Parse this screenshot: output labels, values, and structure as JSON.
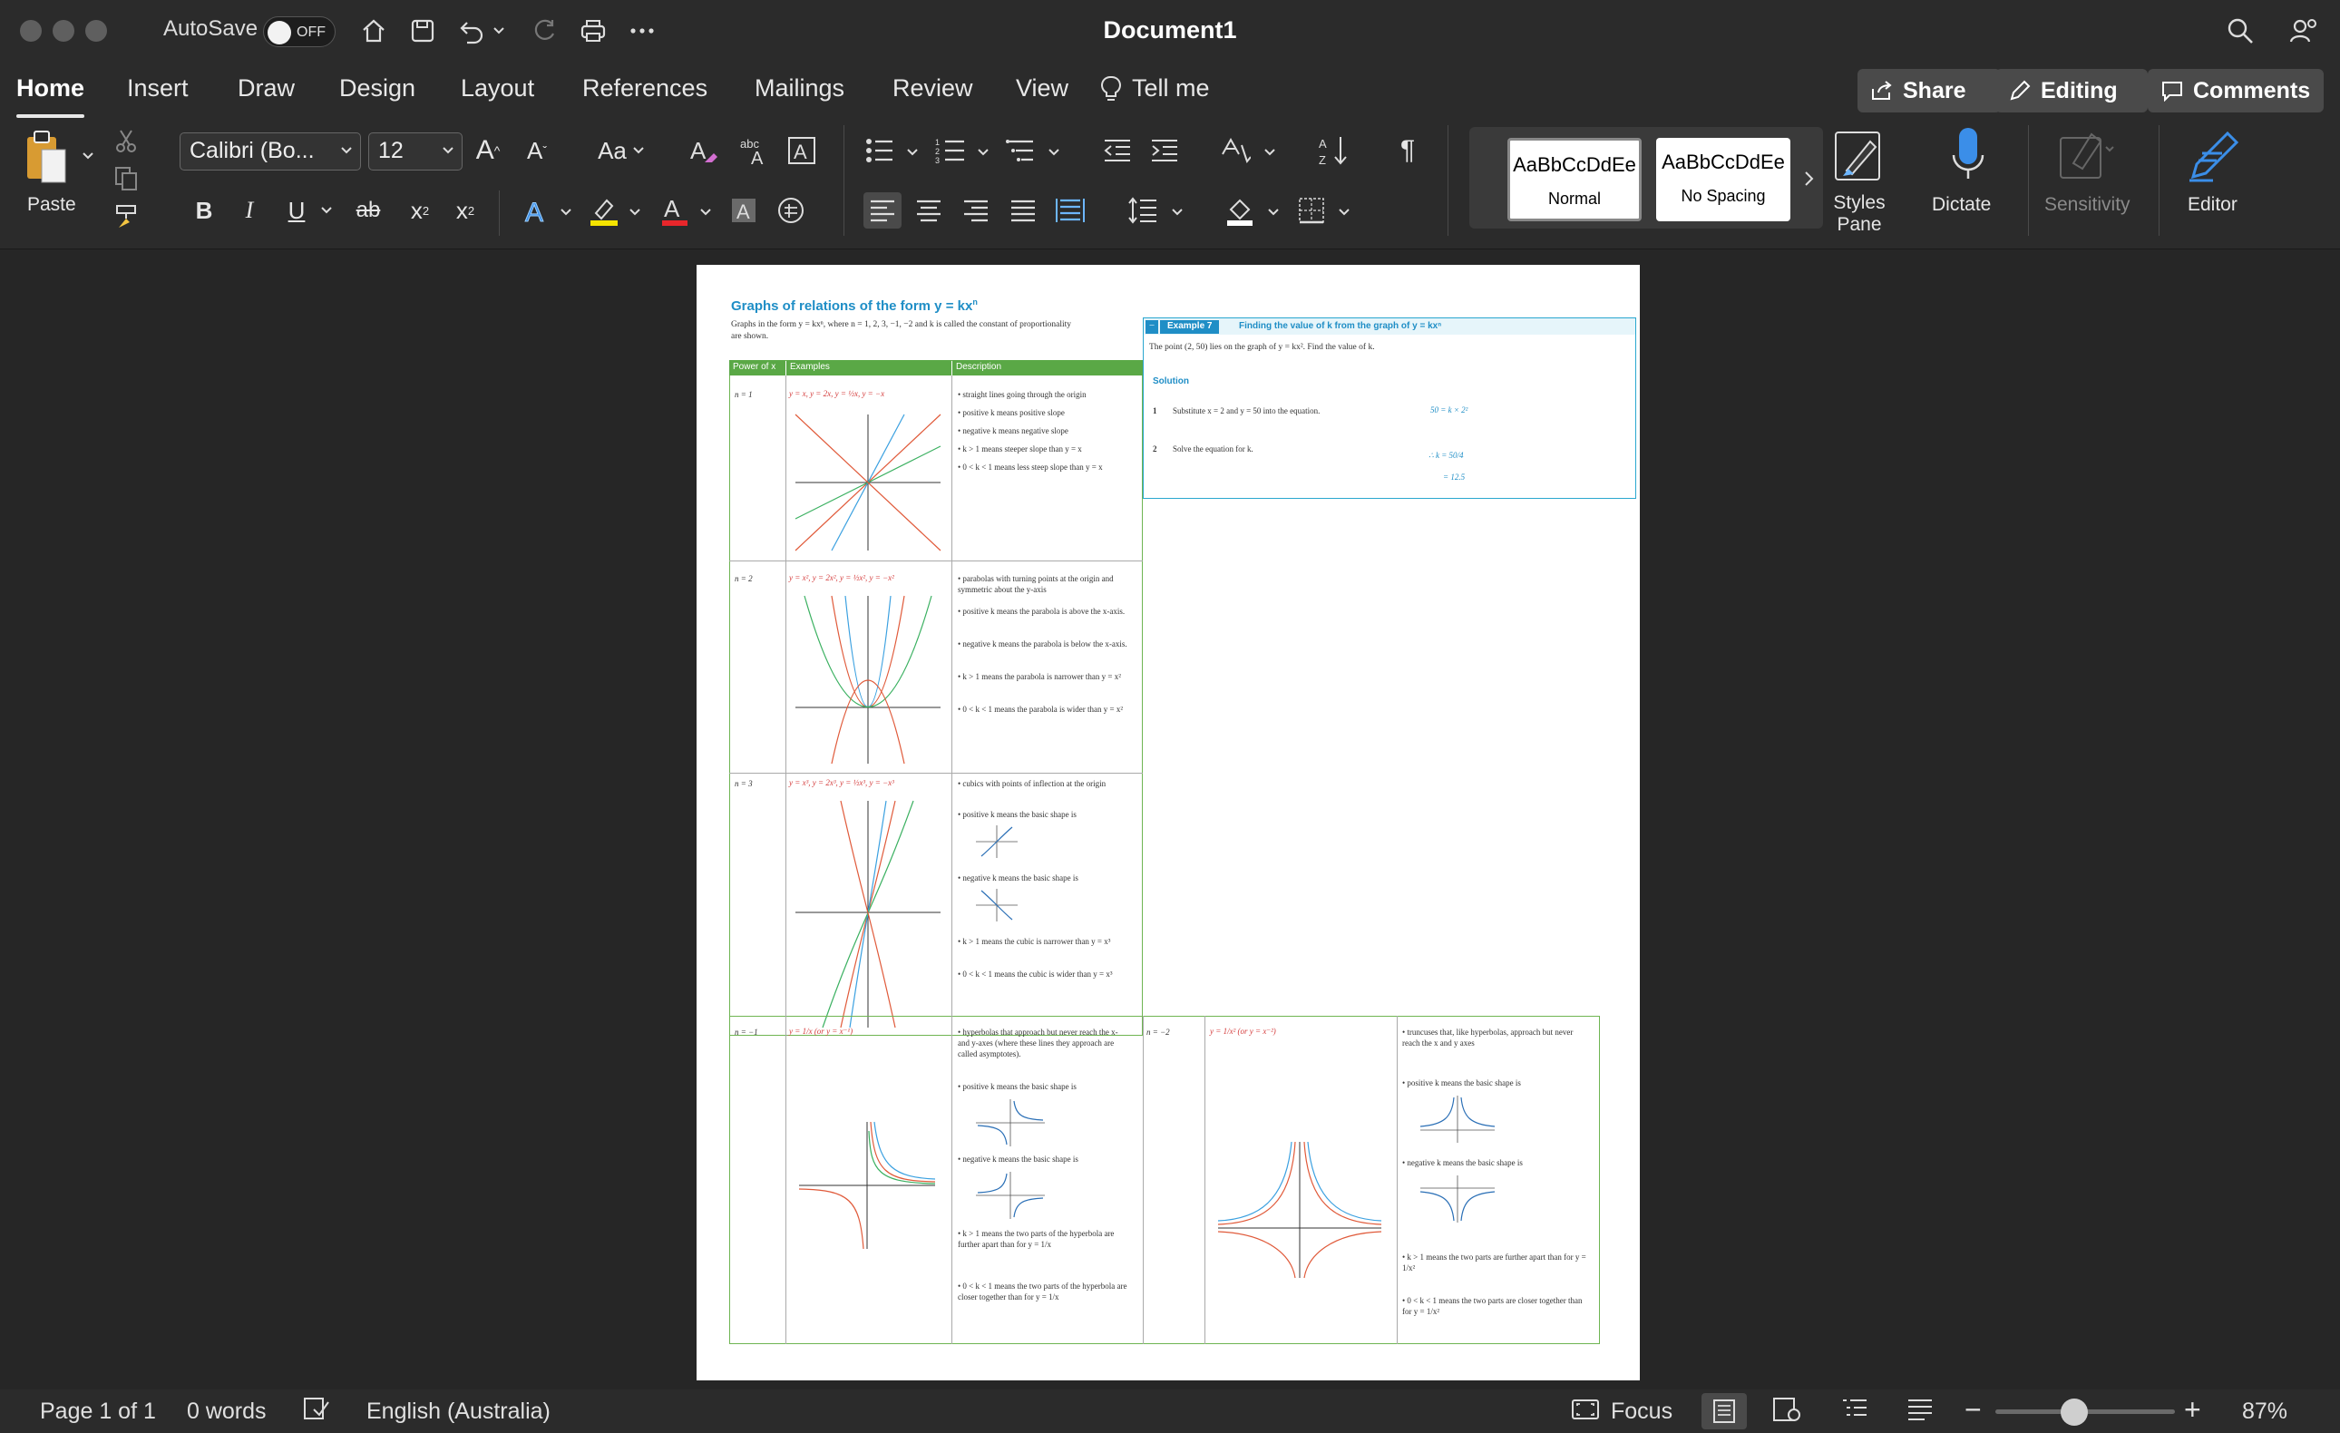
{
  "titlebar": {
    "autosave_label": "AutoSave",
    "autosave_state": "OFF",
    "document_title": "Document1"
  },
  "tabs": [
    "Home",
    "Insert",
    "Draw",
    "Design",
    "Layout",
    "References",
    "Mailings",
    "Review",
    "View"
  ],
  "tell_me": "Tell me",
  "buttons": {
    "share": "Share",
    "editing": "Editing",
    "comments": "Comments"
  },
  "ribbon": {
    "paste": "Paste",
    "font_name": "Calibri (Bo...",
    "font_size": "12",
    "change_case": "Aa",
    "styles": [
      {
        "preview": "AaBbCcDdEe",
        "name": "Normal"
      },
      {
        "preview": "AaBbCcDdEe",
        "name": "No Spacing"
      }
    ],
    "styles_pane": "Styles\nPane",
    "styles_pane_l1": "Styles",
    "styles_pane_l2": "Pane",
    "dictate": "Dictate",
    "sensitivity": "Sensitivity",
    "editor": "Editor",
    "bold": "B",
    "italic": "I",
    "underline": "U",
    "strike": "ab",
    "subscript": "x",
    "superscript": "x"
  },
  "document": {
    "heading": "Graphs of relations of the form y = kx",
    "heading_exp": "n",
    "intro_l1": "Graphs in the form y = kxⁿ, where n = 1, 2, 3, −1, −2 and k is called the constant of proportionality",
    "intro_l2": "are shown.",
    "table_headers": [
      "Power of x",
      "Examples",
      "Description"
    ],
    "rows": [
      {
        "power": "n = 1",
        "examples": "y = x, y = 2x, y = ½x, y = −x",
        "bullets": [
          "straight lines going through the origin",
          "positive k means positive slope",
          "negative k means negative slope",
          "k > 1 means steeper slope than y = x",
          "0 < k < 1 means less steep slope than y = x"
        ]
      },
      {
        "power": "n = 2",
        "examples": "y = x², y = 2x², y = ½x², y = −x²",
        "bullets": [
          "parabolas with turning points at the origin and symmetric about the y-axis",
          "positive k means the parabola is above the x-axis.",
          "negative k means the parabola is below the x-axis.",
          "k > 1 means the parabola is narrower than y = x²",
          "0 < k < 1 means the parabola is wider than y = x²"
        ]
      },
      {
        "power": "n = 3",
        "examples": "y = x³, y = 2x³, y = ½x³, y = −x³",
        "bullets": [
          "cubics with points of inflection at the origin",
          "positive k means the basic shape is",
          "negative k means the basic shape is",
          "k > 1 means the cubic is narrower than y = x³",
          "0 < k < 1 means the cubic is wider than y = x³"
        ]
      },
      {
        "power": "n = −1",
        "examples": "y = 1/x (or y = x⁻¹)",
        "bullets": [
          "hyperbolas that approach but never reach the x- and y-axes (where these lines they approach are called asymptotes).",
          "positive k means the basic shape is",
          "negative k means the basic shape is",
          "k > 1 means the two parts of the hyperbola are further apart than for y = 1/x",
          "0 < k < 1 means the two parts of the hyperbola are closer together than for y = 1/x"
        ]
      },
      {
        "power": "n = −2",
        "examples": "y = 1/x² (or y = x⁻²)",
        "bullets": [
          "truncuses that, like hyperbolas, approach but never reach the x and y axes",
          "positive k means the basic shape is",
          "negative k means the basic shape is",
          "k > 1 means the two parts are further apart than for y = 1/x²",
          "0 < k < 1 means the two parts are closer together than for y = 1/x²"
        ]
      }
    ],
    "example": {
      "tag": "Example 7",
      "title": "Finding the value of k from the graph of y = kxⁿ",
      "statement": "The point (2, 50) lies on the graph of y = kx². Find the value of k.",
      "solution_label": "Solution",
      "steps": [
        {
          "num": "1",
          "text": "Substitute x = 2 and y = 50 into the equation.",
          "math": "50 = k × 2²"
        },
        {
          "num": "2",
          "text": "Solve the equation for k.",
          "math": "∴ k = 50/4",
          "math2": "= 12.5"
        }
      ]
    }
  },
  "statusbar": {
    "page": "Page 1 of 1",
    "words": "0 words",
    "language": "English (Australia)",
    "focus": "Focus",
    "zoom": "87%"
  },
  "colors": {
    "accent_blue": "#1f8ec6",
    "table_green": "#5aa846",
    "ui_dark": "#2b2b2b"
  }
}
